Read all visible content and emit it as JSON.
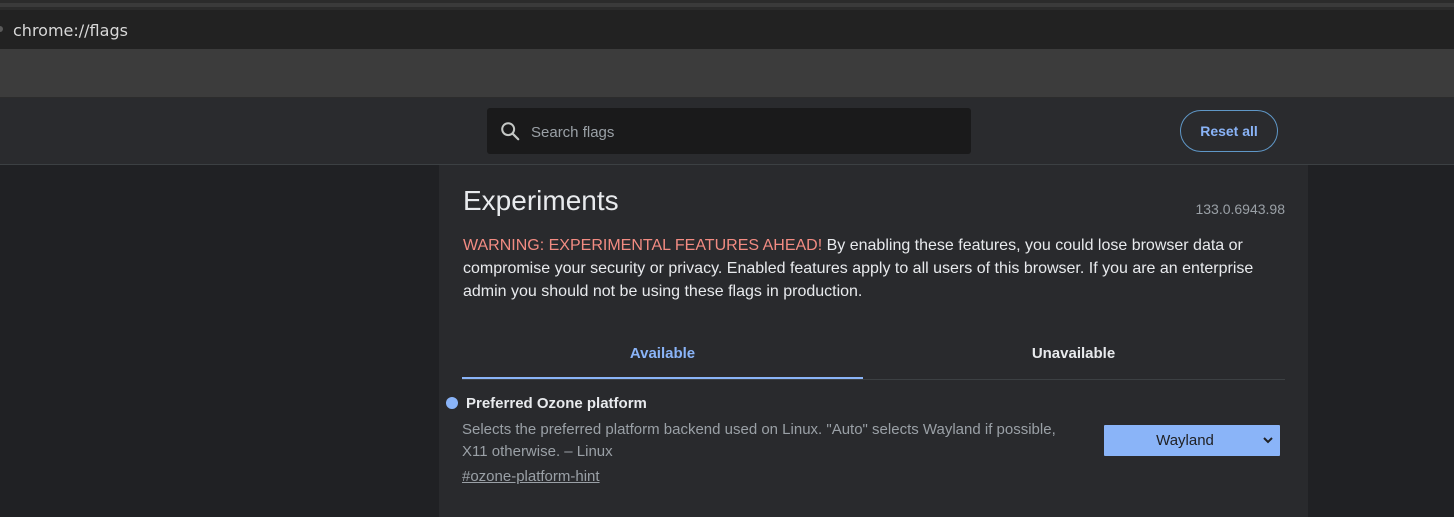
{
  "address_bar": {
    "url": "chrome://flags"
  },
  "search": {
    "placeholder": "Search flags",
    "value": ""
  },
  "header": {
    "reset_label": "Reset all"
  },
  "main": {
    "title": "Experiments",
    "version": "133.0.6943.98",
    "warning_label": "WARNING: EXPERIMENTAL FEATURES AHEAD!",
    "warning_text": " By enabling these features, you could lose browser data or compromise your security or privacy. Enabled features apply to all users of this browser. If you are an enterprise admin you should not be using these flags in production.",
    "tabs": [
      {
        "label": "Available",
        "active": true
      },
      {
        "label": "Unavailable",
        "active": false
      }
    ]
  },
  "flags": [
    {
      "name": "Preferred Ozone platform",
      "description": "Selects the preferred platform backend used on Linux. \"Auto\" selects Wayland if possible, X11 otherwise. – Linux",
      "link": "#ozone-platform-hint",
      "selected_value": "Wayland"
    }
  ],
  "colors": {
    "accent": "#8ab4f8",
    "warning": "#f28b82",
    "background": "#202124",
    "panel": "#292a2d"
  }
}
